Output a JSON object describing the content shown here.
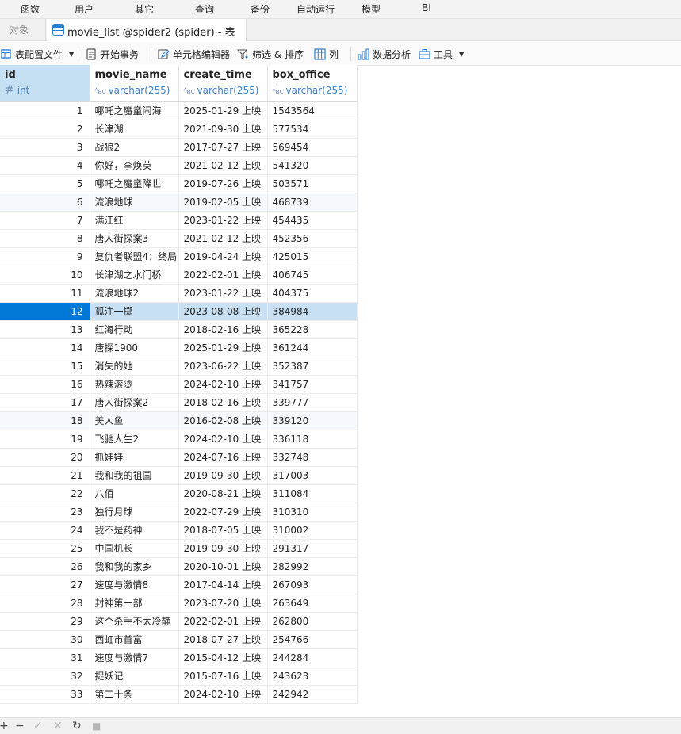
{
  "menu": {
    "items": [
      "函数",
      "用户",
      "其它",
      "查询",
      "备份",
      "自动运行",
      "模型",
      "BI"
    ]
  },
  "tabs": {
    "objects_label": "对象",
    "active_label": "movie_list @spider2 (spider) - 表"
  },
  "toolbar": {
    "table_config": "表配置文件",
    "begin_transaction": "开始事务",
    "cell_editor": "单元格编辑器",
    "filter_sort": "筛选 & 排序",
    "columns": "列",
    "data_analysis": "数据分析",
    "tools": "工具"
  },
  "grid": {
    "columns": [
      {
        "name": "id",
        "type": "int"
      },
      {
        "name": "movie_name",
        "type": "varchar(255)"
      },
      {
        "name": "create_time",
        "type": "varchar(255)"
      },
      {
        "name": "box_office",
        "type": "varchar(255)"
      }
    ],
    "rows": [
      {
        "id": "1",
        "movie_name": "哪吒之魔童闹海",
        "create_time": "2025-01-29 上映",
        "box_office": "1543564"
      },
      {
        "id": "2",
        "movie_name": "长津湖",
        "create_time": "2021-09-30 上映",
        "box_office": "577534"
      },
      {
        "id": "3",
        "movie_name": "战狼2",
        "create_time": "2017-07-27 上映",
        "box_office": "569454"
      },
      {
        "id": "4",
        "movie_name": "你好，李焕英",
        "create_time": "2021-02-12 上映",
        "box_office": "541320"
      },
      {
        "id": "5",
        "movie_name": "哪吒之魔童降世",
        "create_time": "2019-07-26 上映",
        "box_office": "503571"
      },
      {
        "id": "6",
        "movie_name": "流浪地球",
        "create_time": "2019-02-05 上映",
        "box_office": "468739"
      },
      {
        "id": "7",
        "movie_name": "满江红",
        "create_time": "2023-01-22 上映",
        "box_office": "454435"
      },
      {
        "id": "8",
        "movie_name": "唐人街探案3",
        "create_time": "2021-02-12 上映",
        "box_office": "452356"
      },
      {
        "id": "9",
        "movie_name": "复仇者联盟4：终局",
        "create_time": "2019-04-24 上映",
        "box_office": "425015"
      },
      {
        "id": "10",
        "movie_name": "长津湖之水门桥",
        "create_time": "2022-02-01 上映",
        "box_office": "406745"
      },
      {
        "id": "11",
        "movie_name": "流浪地球2",
        "create_time": "2023-01-22 上映",
        "box_office": "404375"
      },
      {
        "id": "12",
        "movie_name": "孤注一掷",
        "create_time": "2023-08-08 上映",
        "box_office": "384984"
      },
      {
        "id": "13",
        "movie_name": "红海行动",
        "create_time": "2018-02-16 上映",
        "box_office": "365228"
      },
      {
        "id": "14",
        "movie_name": "唐探1900",
        "create_time": "2025-01-29 上映",
        "box_office": "361244"
      },
      {
        "id": "15",
        "movie_name": "消失的她",
        "create_time": "2023-06-22 上映",
        "box_office": "352387"
      },
      {
        "id": "16",
        "movie_name": "热辣滚烫",
        "create_time": "2024-02-10 上映",
        "box_office": "341757"
      },
      {
        "id": "17",
        "movie_name": "唐人街探案2",
        "create_time": "2018-02-16 上映",
        "box_office": "339777"
      },
      {
        "id": "18",
        "movie_name": "美人鱼",
        "create_time": "2016-02-08 上映",
        "box_office": "339120"
      },
      {
        "id": "19",
        "movie_name": "飞驰人生2",
        "create_time": "2024-02-10 上映",
        "box_office": "336118"
      },
      {
        "id": "20",
        "movie_name": "抓娃娃",
        "create_time": "2024-07-16 上映",
        "box_office": "332748"
      },
      {
        "id": "21",
        "movie_name": "我和我的祖国",
        "create_time": "2019-09-30 上映",
        "box_office": "317003"
      },
      {
        "id": "22",
        "movie_name": "八佰",
        "create_time": "2020-08-21 上映",
        "box_office": "311084"
      },
      {
        "id": "23",
        "movie_name": "独行月球",
        "create_time": "2022-07-29 上映",
        "box_office": "310310"
      },
      {
        "id": "24",
        "movie_name": "我不是药神",
        "create_time": "2018-07-05 上映",
        "box_office": "310002"
      },
      {
        "id": "25",
        "movie_name": "中国机长",
        "create_time": "2019-09-30 上映",
        "box_office": "291317"
      },
      {
        "id": "26",
        "movie_name": "我和我的家乡",
        "create_time": "2020-10-01 上映",
        "box_office": "282992"
      },
      {
        "id": "27",
        "movie_name": "速度与激情8",
        "create_time": "2017-04-14 上映",
        "box_office": "267093"
      },
      {
        "id": "28",
        "movie_name": "封神第一部",
        "create_time": "2023-07-20 上映",
        "box_office": "263649"
      },
      {
        "id": "29",
        "movie_name": "这个杀手不太冷静",
        "create_time": "2022-02-01 上映",
        "box_office": "262800"
      },
      {
        "id": "30",
        "movie_name": "西虹市首富",
        "create_time": "2018-07-27 上映",
        "box_office": "254766"
      },
      {
        "id": "31",
        "movie_name": "速度与激情7",
        "create_time": "2015-04-12 上映",
        "box_office": "244284"
      },
      {
        "id": "32",
        "movie_name": "捉妖记",
        "create_time": "2015-07-16 上映",
        "box_office": "243623"
      },
      {
        "id": "33",
        "movie_name": "第二十条",
        "create_time": "2024-02-10 上映",
        "box_office": "242942"
      }
    ],
    "selected_row": 12,
    "highlighted_rows": [
      6,
      18
    ]
  },
  "statusbar": {
    "add": "+",
    "delete": "−",
    "apply": "✓",
    "discard": "✕",
    "refresh": "↻",
    "stop": "■"
  },
  "colors": {
    "accent": "#0078d7",
    "selection": "#c7e0f4",
    "type_text": "#3c7fc0"
  }
}
